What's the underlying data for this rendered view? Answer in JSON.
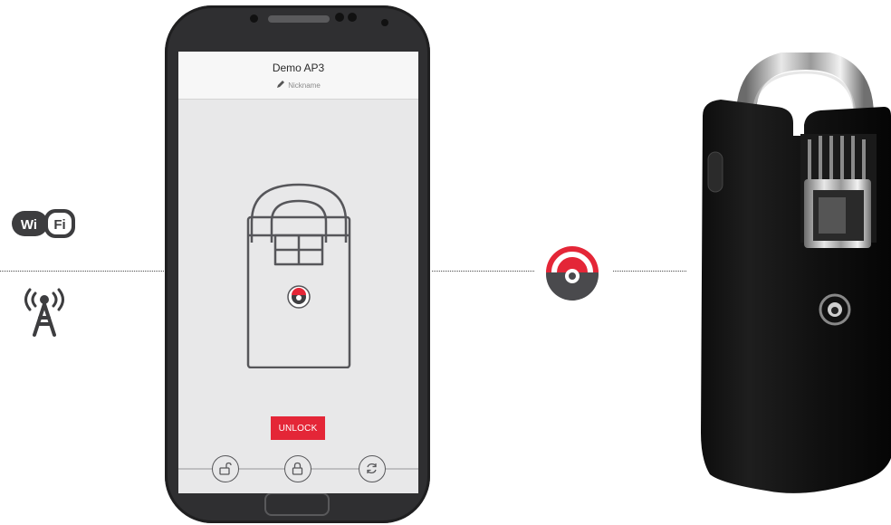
{
  "app": {
    "device_name": "Demo AP3",
    "nickname_label": "Nickname",
    "unlock_label": "UNLOCK"
  },
  "icons": {
    "wifi": "wifi-badge-icon",
    "tower": "radio-tower-icon",
    "pencil": "pencil-icon",
    "unlocked": "unlocked-padlock-icon",
    "locked": "locked-padlock-icon",
    "sync": "sync-icon",
    "brand": "brand-logo-icon"
  },
  "colors": {
    "accent": "#e42637",
    "phone_body": "#2f2f31",
    "screen_bg": "#e8e8e9",
    "icon_stroke": "#57575a"
  }
}
